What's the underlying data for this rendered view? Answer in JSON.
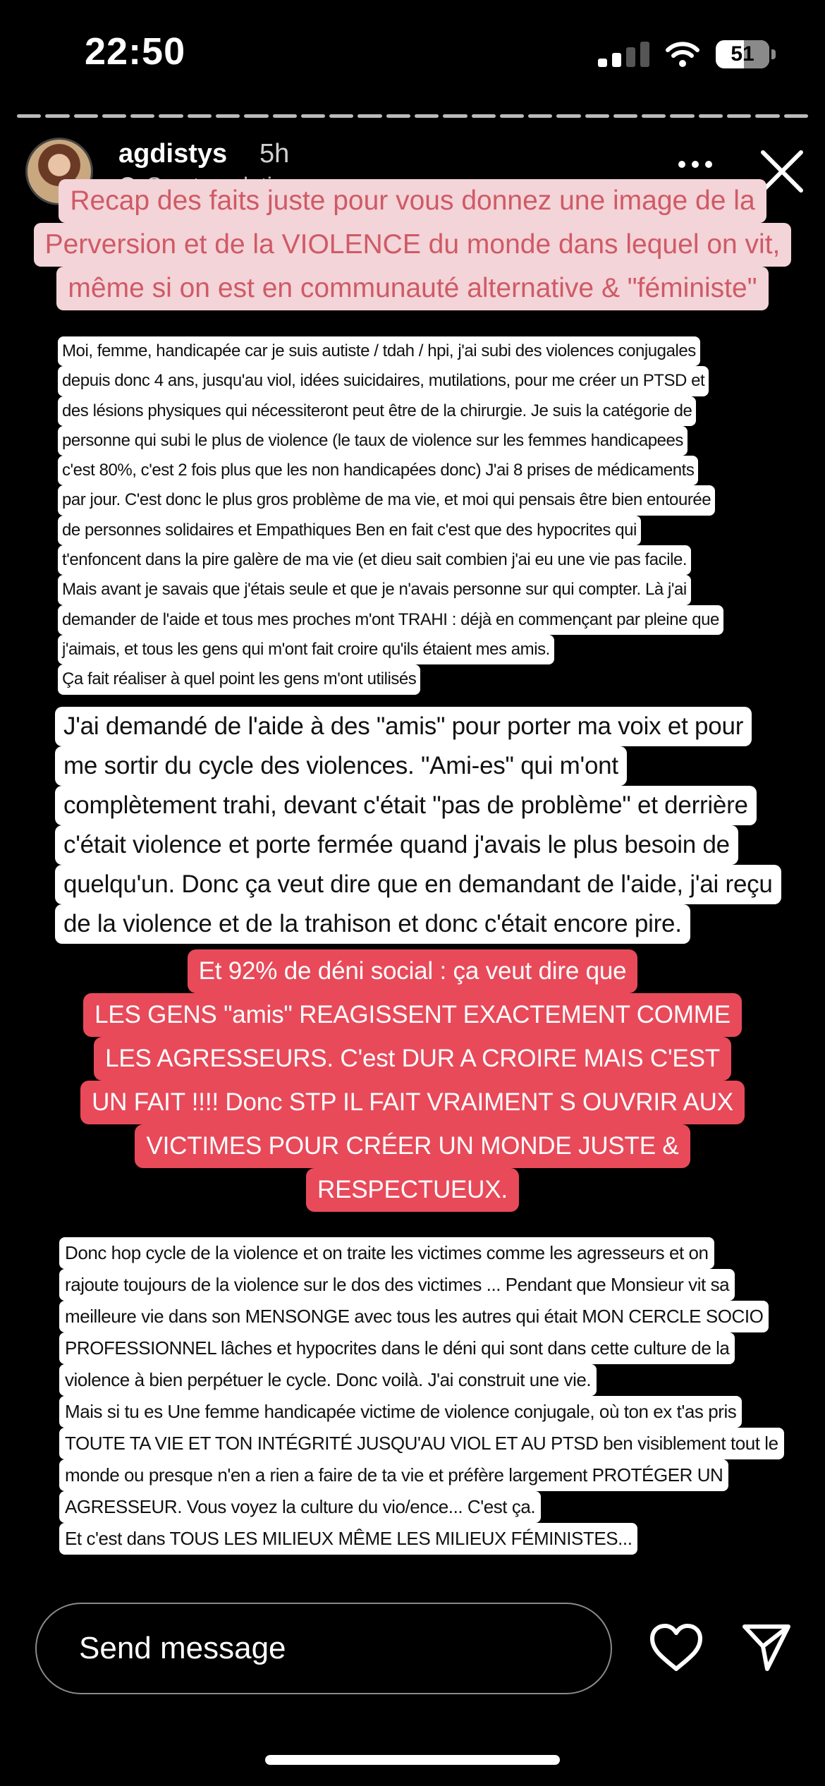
{
  "status_bar": {
    "time": "22:50",
    "battery": "51"
  },
  "header": {
    "username": "agdistys",
    "time_ago": "5h",
    "see_translation": "See translation",
    "chevron": "›"
  },
  "title_block": {
    "lines": [
      "Recap des faits juste pour vous donnez une image de la",
      "Perversion et de la VIOLENCE du monde dans lequel on vit,",
      "même si on est en communauté alternative & \"féministe\""
    ]
  },
  "paragraph1": {
    "lines": [
      "Moi, femme, handicapée car je suis autiste / tdah / hpi, j'ai subi des violences conjugales",
      "depuis donc 4 ans, jusqu'au viol, idées suicidaires, mutilations, pour me créer un PTSD et",
      "des lésions physiques qui nécessiteront peut être de la chirurgie. Je suis la catégorie de",
      "personne qui subi le plus de violence (le taux de violence sur les femmes handicapees",
      "c'est 80%, c'est 2 fois plus que les non handicapées donc) J'ai 8 prises de  médicaments",
      "par jour. C'est donc le plus gros problème de ma vie, et moi qui pensais être bien entourée",
      "de personnes solidaires et Empathiques Ben en fait c'est que des hypocrites qui",
      "t'enfoncent dans la pire galère de ma vie (et dieu sait combien j'ai eu une vie pas facile.",
      "Mais avant je savais que j'étais seule et que je n'avais personne sur qui compter. Là j'ai",
      "demander de l'aide et tous mes proches m'ont TRAHI : déjà en commençant par pleine que",
      "j'aimais, et tous les gens qui m'ont fait croire qu'ils étaient mes amis.",
      "Ça fait réaliser à quel point les gens m'ont utilisés"
    ]
  },
  "paragraph2": {
    "lines": [
      "J'ai demandé de l'aide à des \"amis\" pour porter ma voix et pour",
      "me sortir du cycle des violences. \"Ami-es\" qui m'ont",
      "complètement trahi, devant c'était \"pas de problème\" et derrière",
      "c'était violence et porte fermée quand j'avais le plus besoin de",
      "quelqu'un. Donc ça veut dire que en demandant de l'aide, j'ai reçu",
      "de la violence et de la trahison et donc c'était encore pire."
    ]
  },
  "highlight_block": {
    "lines": [
      "Et 92% de déni social : ça veut dire que",
      "LES GENS \"amis\" REAGISSENT EXACTEMENT COMME",
      "LES AGRESSEURS.  C'est DUR A CROIRE MAIS C'EST",
      "UN FAIT !!!! Donc STP IL FAIT VRAIMENT S OUVRIR AUX",
      "VICTIMES POUR CRÉER UN MONDE JUSTE &",
      "RESPECTUEUX."
    ]
  },
  "paragraph3": {
    "lines": [
      "Donc hop cycle de la violence et on traite les victimes comme les agresseurs et on",
      "rajoute toujours de la violence sur le dos des victimes ... Pendant que Monsieur vit sa",
      "meilleure vie dans son MENSONGE avec tous les autres qui était MON CERCLE SOCIO",
      "PROFESSIONNEL lâches et hypocrites dans le déni qui sont dans cette culture de la",
      "violence à bien perpétuer le cycle. Donc voilà. J'ai construit une vie.",
      "Mais si tu es Une femme handicapée victime de violence conjugale, où ton ex t'as pris",
      "TOUTE TA VIE ET TON INTÉGRITÉ JUSQU'AU VIOL ET AU PTSD ben visiblement tout le",
      "monde ou presque n'en a rien a faire de ta vie et préfère largement PROTÉGER UN",
      "AGRESSEUR. Vous voyez la culture du vio/ence... C'est ça.",
      "Et c'est dans TOUS LES MILIEUX MÊME LES MILIEUX FÉMINISTES..."
    ]
  },
  "footer": {
    "message_placeholder": "Send message"
  },
  "icons": {
    "wifi": "wifi-icon",
    "cellular": "cellular-signal-icon",
    "battery": "battery-icon",
    "more": "more-options-icon",
    "close": "close-icon",
    "like": "heart-icon",
    "send": "send-icon"
  }
}
